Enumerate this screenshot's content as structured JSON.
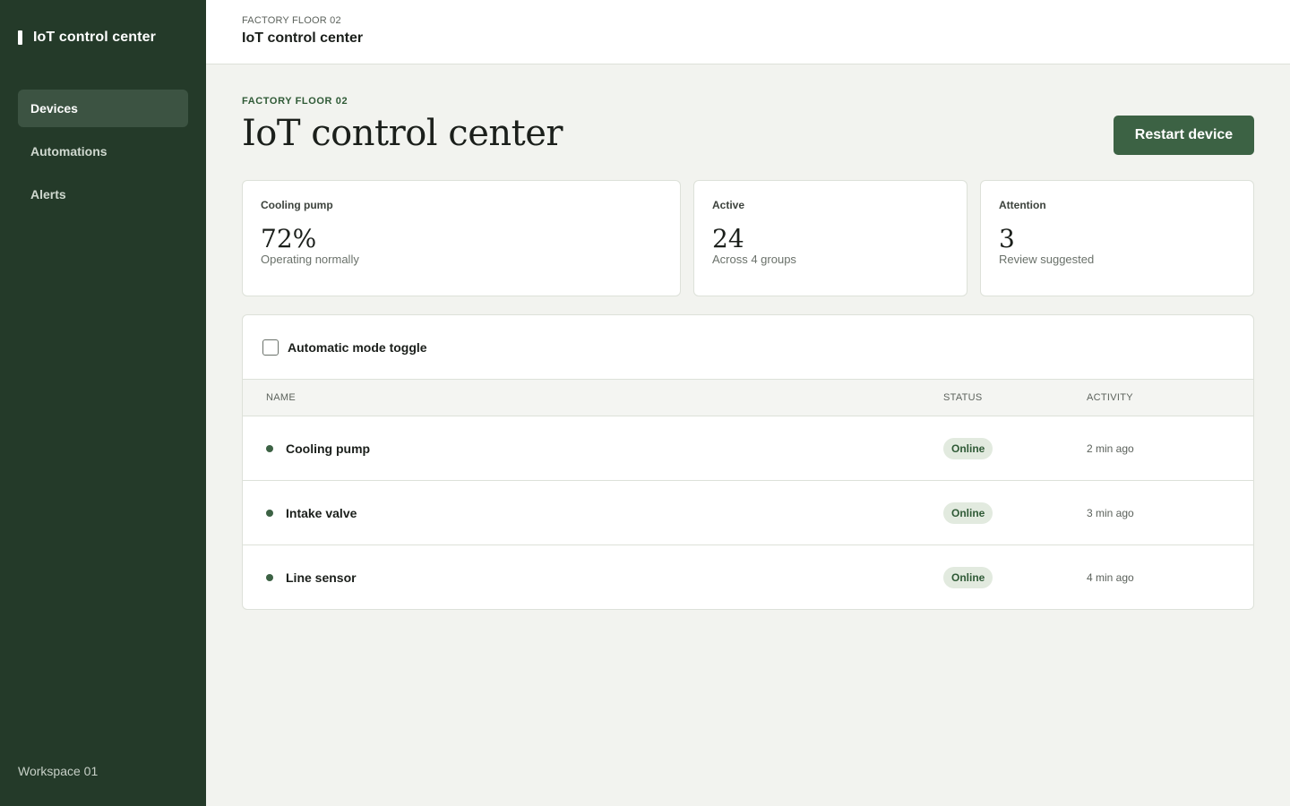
{
  "app": {
    "name": "IoT control center"
  },
  "sidebar": {
    "items": [
      {
        "label": "Devices",
        "active": true
      },
      {
        "label": "Automations",
        "active": false
      },
      {
        "label": "Alerts",
        "active": false
      }
    ],
    "workspace": "Workspace 01"
  },
  "header": {
    "breadcrumb": "FACTORY FLOOR 02",
    "title": "IoT control center"
  },
  "main": {
    "eyebrow": "FACTORY FLOOR 02",
    "title": "IoT control center",
    "primary_action": "Restart device"
  },
  "stats": [
    {
      "label": "Cooling pump",
      "value": "72%",
      "sub": "Operating normally"
    },
    {
      "label": "Active",
      "value": "24",
      "sub": "Across 4 groups"
    },
    {
      "label": "Attention",
      "value": "3",
      "sub": "Review suggested"
    }
  ],
  "toggle": {
    "label": "Automatic mode toggle",
    "checked": false
  },
  "table": {
    "columns": [
      "NAME",
      "STATUS",
      "ACTIVITY"
    ],
    "rows": [
      {
        "name": "Cooling pump",
        "status": "Online",
        "activity": "2 min ago"
      },
      {
        "name": "Intake valve",
        "status": "Online",
        "activity": "3 min ago"
      },
      {
        "name": "Line sensor",
        "status": "Online",
        "activity": "4 min ago"
      }
    ]
  },
  "colors": {
    "sidebar_bg": "#243a29",
    "accent": "#3c6244",
    "status_online": "#2f5a36",
    "page_bg": "#f2f3ef"
  }
}
